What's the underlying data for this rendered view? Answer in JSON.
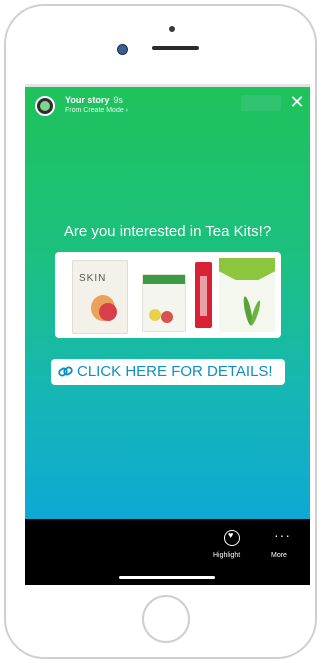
{
  "story": {
    "owner": "Your story",
    "time": "9s",
    "subtitle": "From Create Mode ›",
    "close": "✕"
  },
  "content": {
    "headline": "Are you interested in Tea Kits!?",
    "product_label": "SKIN",
    "cta_icon": "link-icon",
    "cta_text": "CLICK HERE FOR DETAILS!"
  },
  "bottom": {
    "highlight_label": "Highlight",
    "more_label": "More",
    "more_glyph": "···"
  },
  "colors": {
    "gradient_top": "#1fc25a",
    "gradient_bottom": "#0aa2e5",
    "cta_text": "#0d8ec6"
  }
}
